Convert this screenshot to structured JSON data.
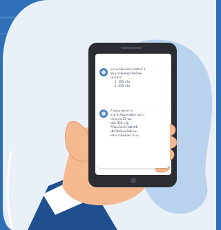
{
  "message_1": {
    "lines": [
      "ควรจะใช้ผงโพรไบโอติกส์ 3",
      "ซองการขัดพรุรูปไฟน์ไทย",
      "เท่าไหร่?",
      "1. 300 กรัม",
      "2. 350 กรัม"
    ]
  },
  "message_2": {
    "lines": [
      "ถ้าคุณอายุระหว่าง",
      "อายุ 3 เดือน ขนมีความยาว",
      "ประมาณ 25 ซม.",
      "หนัก 350 กรัม",
      "ก็ให้ผงโพรไบโอติกส์นี้",
      "เพื่อให้เกิดผลได้ดี และ",
      "หลังจากนั้นต่อยาวนาน"
    ]
  },
  "colors": {
    "background": "#2f6fb8",
    "card": "#e9f0f8",
    "blob": "#b9d3ef",
    "phone": "#2b2d33",
    "skin": "#f6b98f",
    "sleeve": "#1f4f8f"
  }
}
